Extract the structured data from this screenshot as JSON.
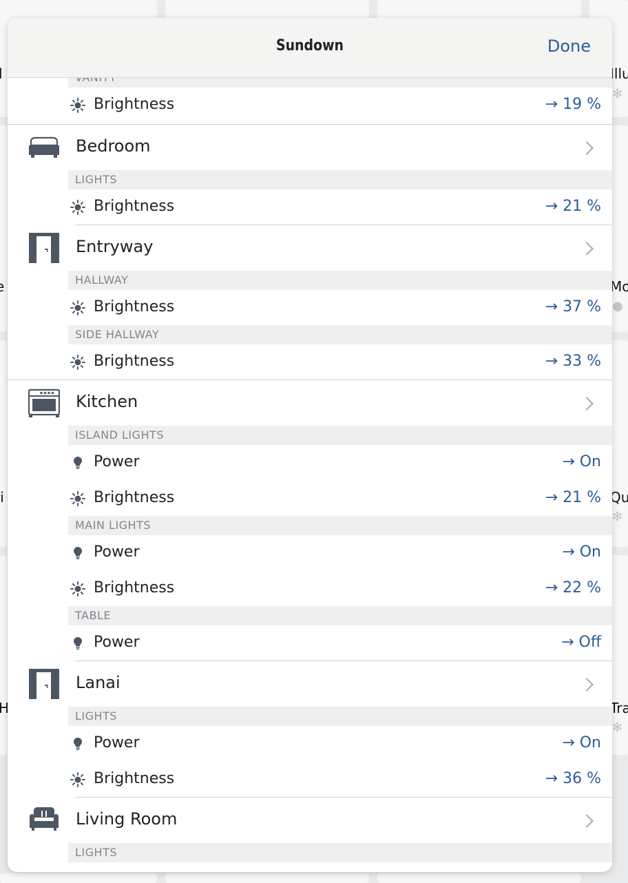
{
  "background": {
    "left_labels": [
      "l",
      "e",
      "ri",
      "H"
    ],
    "right_labels": [
      "Illu",
      "Mo",
      "Qui",
      "Tra"
    ]
  },
  "navbar": {
    "title": "Sundown",
    "done_label": "Done"
  },
  "colors": {
    "accent": "#2b5d96",
    "icon": "#4d5763",
    "group_bg": "#efefef"
  },
  "top_partial": {
    "group": "VANITY",
    "action": {
      "icon": "brightness-icon",
      "label": "Brightness",
      "value": "→ 19 %"
    }
  },
  "rooms": [
    {
      "name": "Bedroom",
      "icon": "bed-icon",
      "groups": [
        {
          "name": "LIGHTS",
          "actions": [
            {
              "icon": "brightness-icon",
              "label": "Brightness",
              "value": "→ 21 %"
            }
          ]
        }
      ]
    },
    {
      "name": "Entryway",
      "icon": "door-icon",
      "groups": [
        {
          "name": "HALLWAY",
          "actions": [
            {
              "icon": "brightness-icon",
              "label": "Brightness",
              "value": "→ 37 %"
            }
          ]
        },
        {
          "name": "SIDE HALLWAY",
          "actions": [
            {
              "icon": "brightness-icon",
              "label": "Brightness",
              "value": "→ 33 %"
            }
          ]
        }
      ]
    },
    {
      "name": "Kitchen",
      "icon": "oven-icon",
      "groups": [
        {
          "name": "ISLAND LIGHTS",
          "actions": [
            {
              "icon": "bulb-icon",
              "label": "Power",
              "value": "→ On"
            },
            {
              "icon": "brightness-icon",
              "label": "Brightness",
              "value": "→ 21 %"
            }
          ]
        },
        {
          "name": "MAIN LIGHTS",
          "actions": [
            {
              "icon": "bulb-icon",
              "label": "Power",
              "value": "→ On"
            },
            {
              "icon": "brightness-icon",
              "label": "Brightness",
              "value": "→ 22 %"
            }
          ]
        },
        {
          "name": "TABLE",
          "actions": [
            {
              "icon": "bulb-icon",
              "label": "Power",
              "value": "→ Off"
            }
          ]
        }
      ]
    },
    {
      "name": "Lanai",
      "icon": "door-icon",
      "groups": [
        {
          "name": "LIGHTS",
          "actions": [
            {
              "icon": "bulb-icon",
              "label": "Power",
              "value": "→ On"
            },
            {
              "icon": "brightness-icon",
              "label": "Brightness",
              "value": "→ 36 %"
            }
          ]
        }
      ]
    },
    {
      "name": "Living Room",
      "icon": "armchair-icon",
      "groups": [
        {
          "name": "LIGHTS",
          "actions": []
        }
      ]
    }
  ]
}
